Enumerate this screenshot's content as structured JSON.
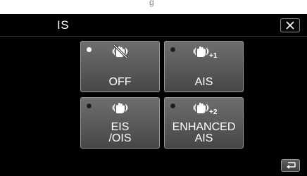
{
  "header": {
    "title": "IS",
    "close_icon": "close-icon",
    "partial_top_text": "g"
  },
  "options": [
    {
      "id": "off",
      "label_lines": [
        "OFF"
      ],
      "selected": true,
      "icon": "stabilizer-off-icon"
    },
    {
      "id": "ais",
      "label_lines": [
        "AIS"
      ],
      "selected": false,
      "icon": "stabilizer-ais-icon",
      "icon_suffix": "+1"
    },
    {
      "id": "eis-ois",
      "label_lines": [
        "EIS",
        "/OIS"
      ],
      "selected": false,
      "icon": "stabilizer-eis-icon"
    },
    {
      "id": "enhanced-ais",
      "label_lines": [
        "ENHANCED",
        "AIS"
      ],
      "selected": false,
      "icon": "stabilizer-enhanced-icon",
      "icon_suffix": "+2"
    }
  ],
  "footer": {
    "back_icon": "return-icon"
  },
  "colors": {
    "background": "#000000",
    "button_top": "#6e6e6e",
    "button_bottom": "#474747",
    "border": "#9a9a9a",
    "text": "#ffffff"
  }
}
